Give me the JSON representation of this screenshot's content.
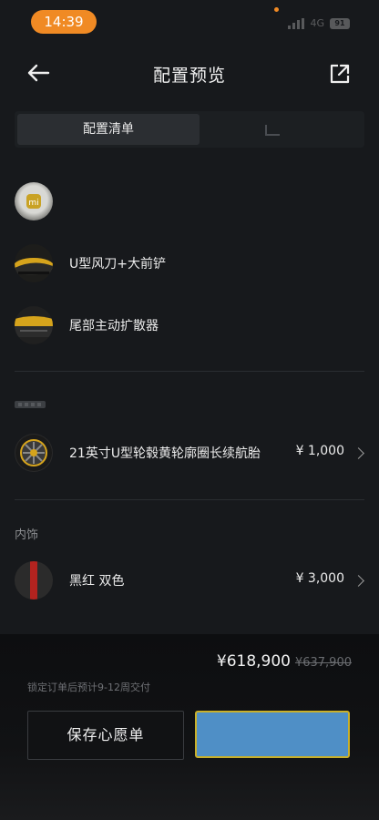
{
  "status_bar": {
    "time": "14:39",
    "network": "4G",
    "battery": "91"
  },
  "header": {
    "title": "配置预览"
  },
  "tabs": [
    {
      "label": "配置清单",
      "active": true
    },
    {
      "label": "",
      "active": false
    }
  ],
  "items": [
    {
      "label": "",
      "price": ""
    },
    {
      "label": "U型风刀+大前铲",
      "price": ""
    },
    {
      "label": "尾部主动扩散器",
      "price": ""
    }
  ],
  "wheels": {
    "label": "21英寸U型轮毂黄轮廓圈长续航胎",
    "price": "¥ 1,000"
  },
  "interior": {
    "section_label": "内饰",
    "label": "黑红 双色",
    "price": "¥ 3,000"
  },
  "summary": {
    "price": "¥618,900",
    "original_price": "¥637,900",
    "delivery_note": "锁定订单后预计9-12周交付"
  },
  "actions": {
    "save_label": "保存心愿单",
    "primary_label": ""
  },
  "colors": {
    "accent_yellow": "#e8b820",
    "primary_button": "#4f8fc6",
    "time_pill": "#f08a24"
  }
}
